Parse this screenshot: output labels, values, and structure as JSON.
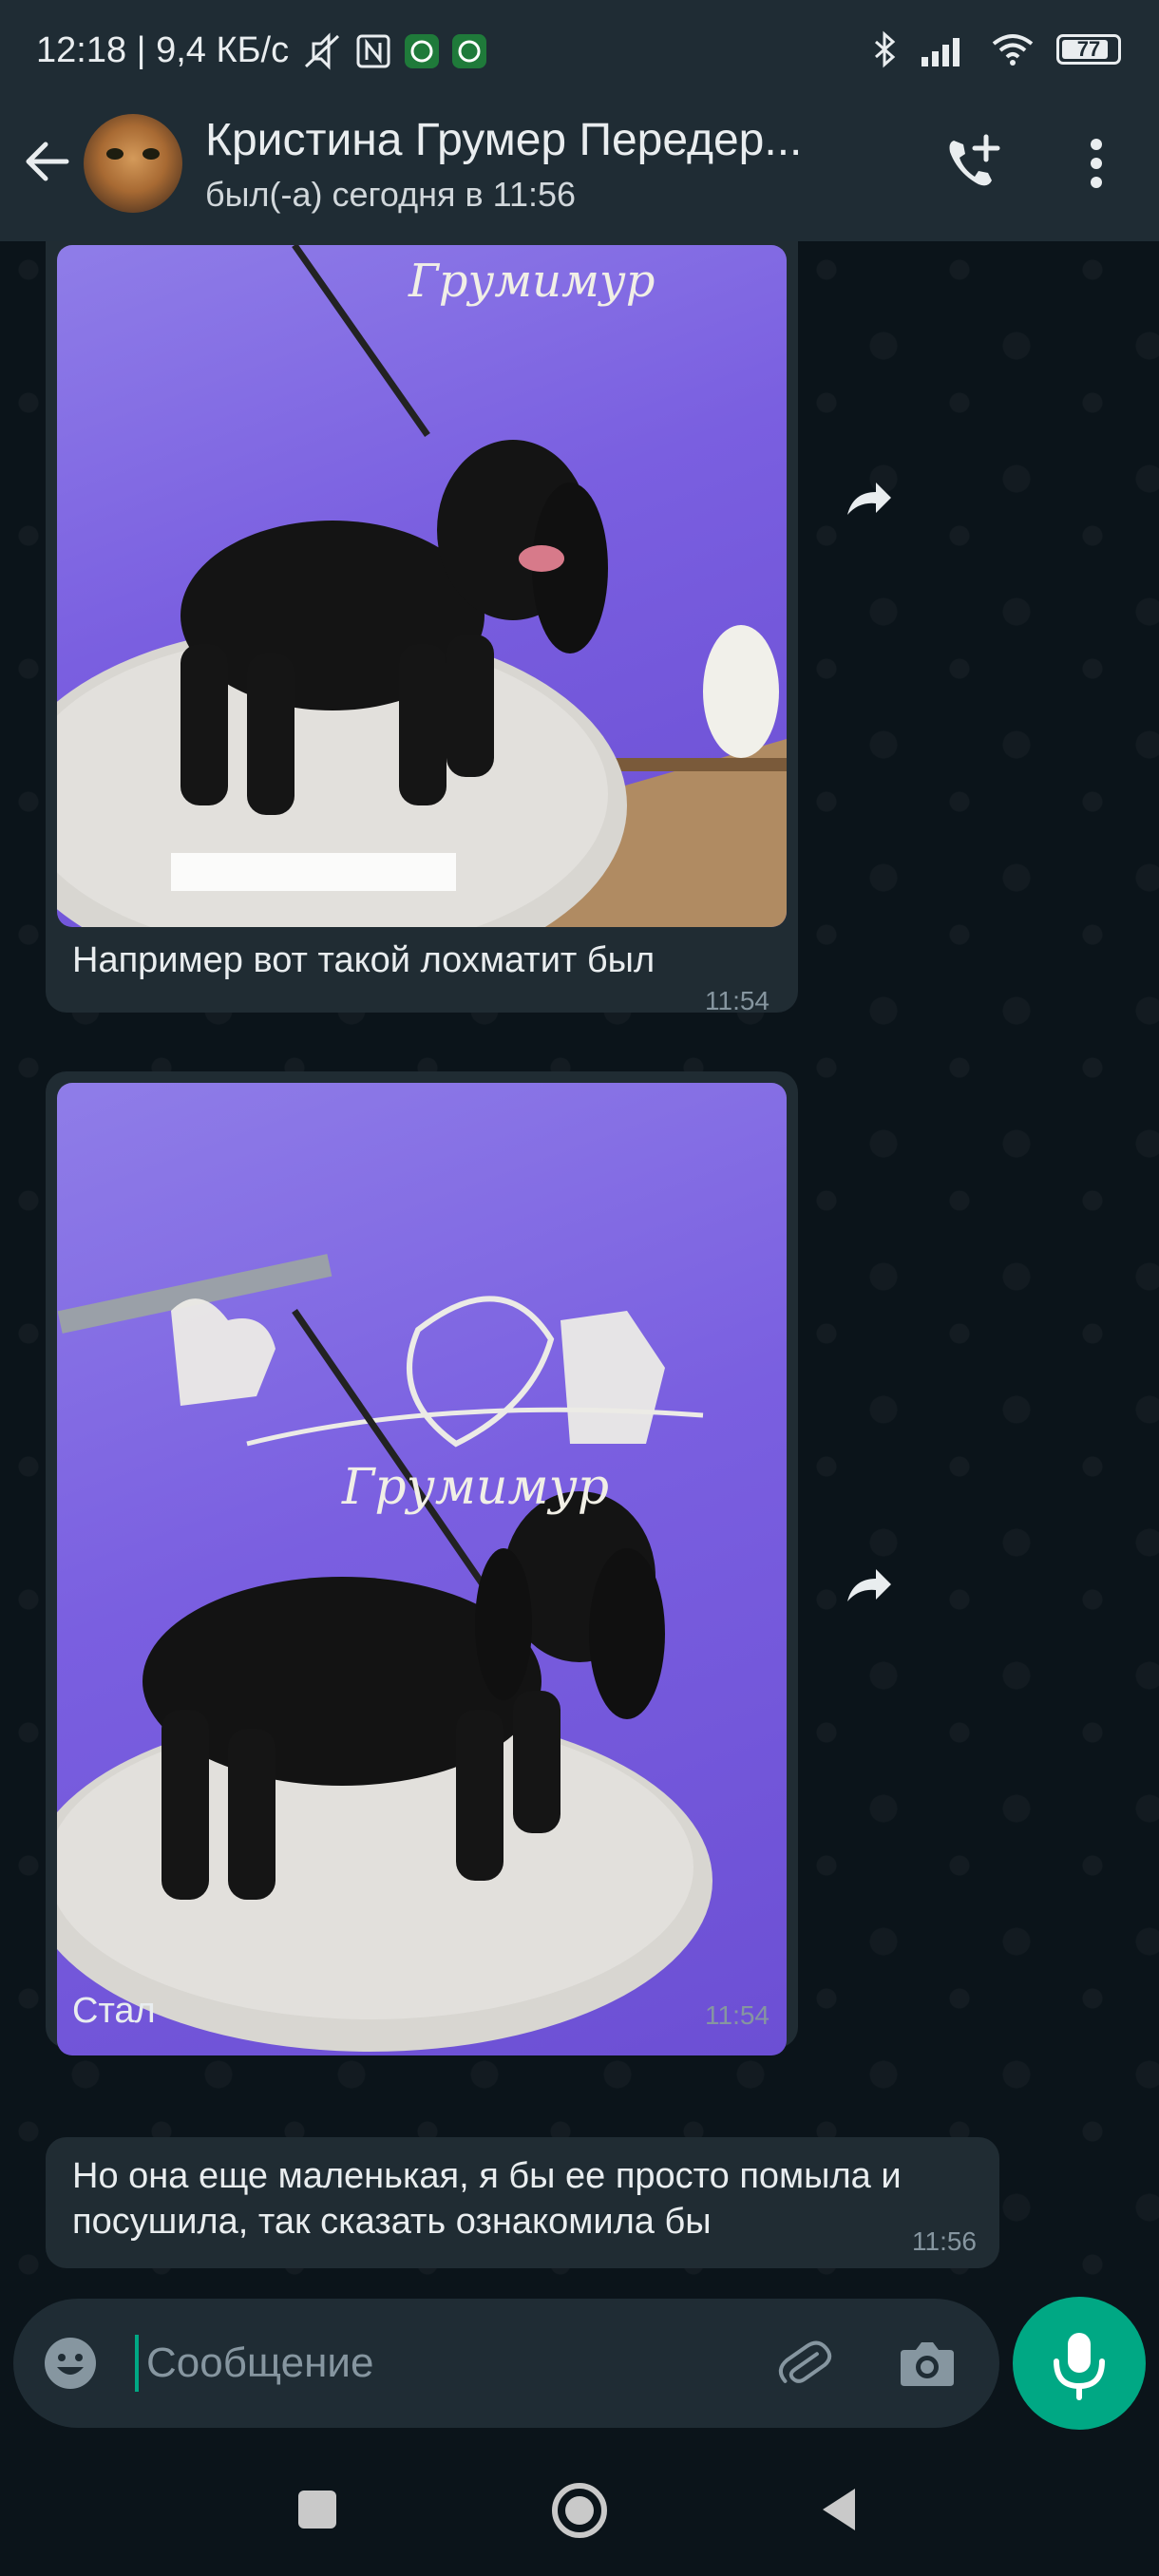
{
  "status_bar": {
    "time_speed": "12:18 | 9,4 КБ/с",
    "battery": "77"
  },
  "header": {
    "contact_name": "Кристина Грумер Передер...",
    "last_seen": "был(-а) сегодня в 11:56"
  },
  "messages": [
    {
      "type": "image",
      "caption": "Например вот такой лохматит был",
      "time": "11:54",
      "photo_text": "Грумимур"
    },
    {
      "type": "image",
      "caption": "Стал",
      "time": "11:54",
      "photo_text": "Грумимур"
    },
    {
      "type": "text",
      "text_line1": "Но она еще маленькая, я бы ее просто помыла и",
      "text_line2": "посушила, так сказать ознакомила бы",
      "time": "11:56"
    }
  ],
  "composer": {
    "placeholder": "Сообщение"
  },
  "colors": {
    "accent": "#00a884",
    "bubble": "#202c33",
    "header": "#1f2c34",
    "background": "#0b141a"
  }
}
